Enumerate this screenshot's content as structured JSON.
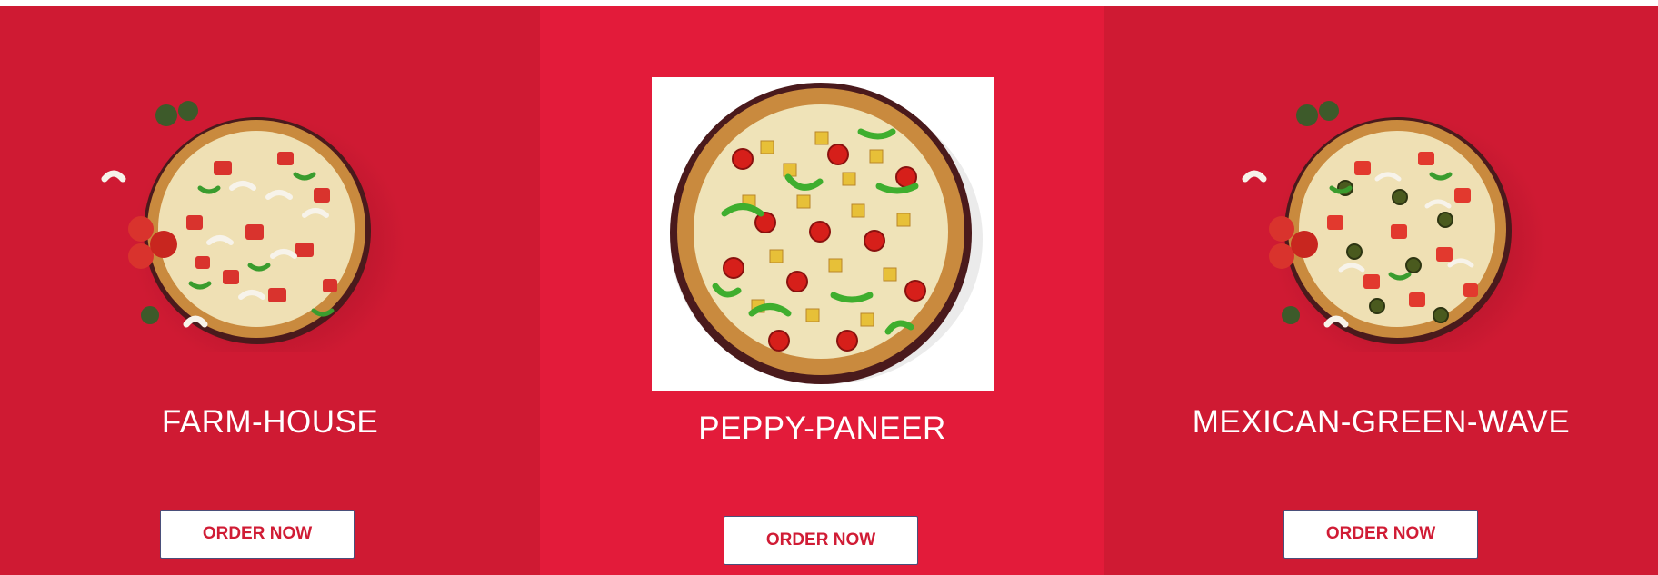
{
  "colors": {
    "card_left_bg": "#cf1a33",
    "card_center_bg": "#e31b3a",
    "card_right_bg": "#cf1a33",
    "button_text": "#d01c35",
    "title_text": "#ffffff"
  },
  "products": [
    {
      "name": "FARM-HOUSE",
      "button_label": "ORDER NOW",
      "image": "farm-house-pizza"
    },
    {
      "name": "PEPPY-PANEER",
      "button_label": "ORDER NOW",
      "image": "peppy-paneer-pizza"
    },
    {
      "name": "MEXICAN-GREEN-WAVE",
      "button_label": "ORDER NOW",
      "image": "mexican-green-wave-pizza"
    }
  ]
}
